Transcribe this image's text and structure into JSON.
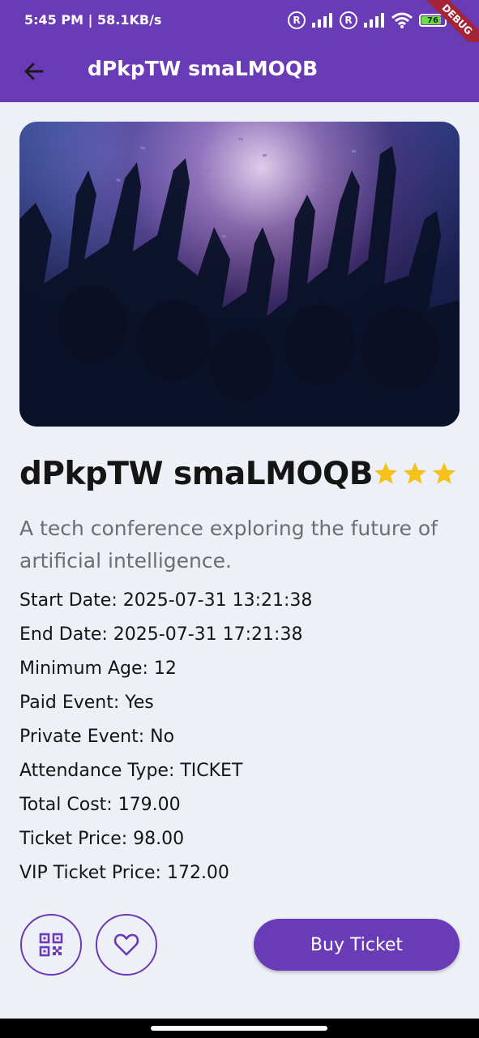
{
  "status_bar": {
    "time": "5:45 PM | 58.1KB/s",
    "battery": "76",
    "debug_label": "DEBUG"
  },
  "app_bar": {
    "title": "dPkpTW smaLMOQB"
  },
  "event": {
    "title": "dPkpTW smaLMOQB",
    "rating": 3,
    "description": "A tech conference exploring the future of artificial intelligence.",
    "details": [
      "Start Date: 2025-07-31 13:21:38",
      "End Date: 2025-07-31 17:21:38",
      "Minimum Age: 12",
      "Paid Event: Yes",
      "Private Event: No",
      "Attendance Type: TICKET",
      "Total Cost: 179.00",
      "Ticket Price: 98.00",
      "VIP Ticket Price: 172.00"
    ]
  },
  "actions": {
    "buy_label": "Buy Ticket"
  },
  "colors": {
    "primary": "#6a3bb7",
    "star": "#f5c21b",
    "background": "#eef0f7"
  }
}
